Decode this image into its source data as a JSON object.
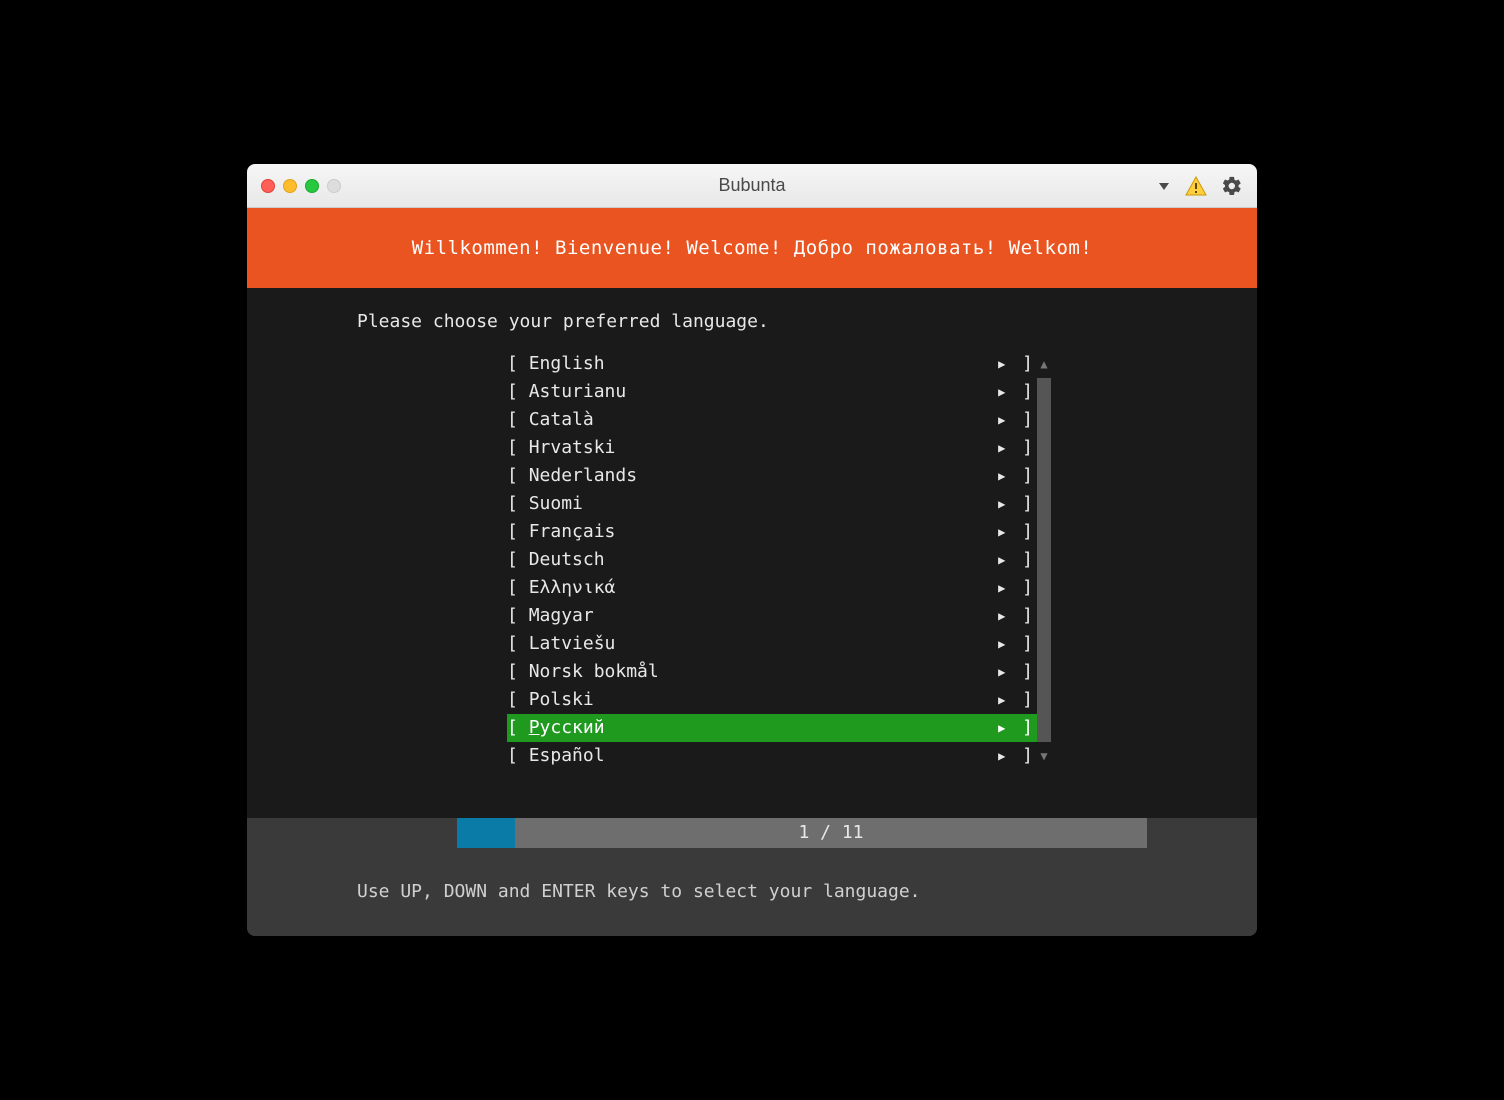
{
  "window": {
    "title": "Bubunta"
  },
  "banner": "Willkommen! Bienvenue! Welcome! Добро пожаловать! Welkom!",
  "prompt": "Please choose your preferred language.",
  "languages": [
    {
      "label": "English",
      "selected": false
    },
    {
      "label": "Asturianu",
      "selected": false
    },
    {
      "label": "Català",
      "selected": false
    },
    {
      "label": "Hrvatski",
      "selected": false
    },
    {
      "label": "Nederlands",
      "selected": false
    },
    {
      "label": "Suomi",
      "selected": false
    },
    {
      "label": "Français",
      "selected": false
    },
    {
      "label": "Deutsch",
      "selected": false
    },
    {
      "label": "Ελληνικά",
      "selected": false
    },
    {
      "label": "Magyar",
      "selected": false
    },
    {
      "label": "Latviešu",
      "selected": false
    },
    {
      "label": "Norsk bokmål",
      "selected": false
    },
    {
      "label": "Polski",
      "selected": false
    },
    {
      "label": "Русский",
      "selected": true
    },
    {
      "label": "Español",
      "selected": false
    }
  ],
  "progress": {
    "current": "1",
    "total": "11",
    "text": "1 / 11"
  },
  "footer": "Use UP, DOWN and ENTER keys to select your language.",
  "colors": {
    "accent": "#e95420",
    "selected": "#1f9a1f",
    "progress": "#0a7aa6"
  }
}
